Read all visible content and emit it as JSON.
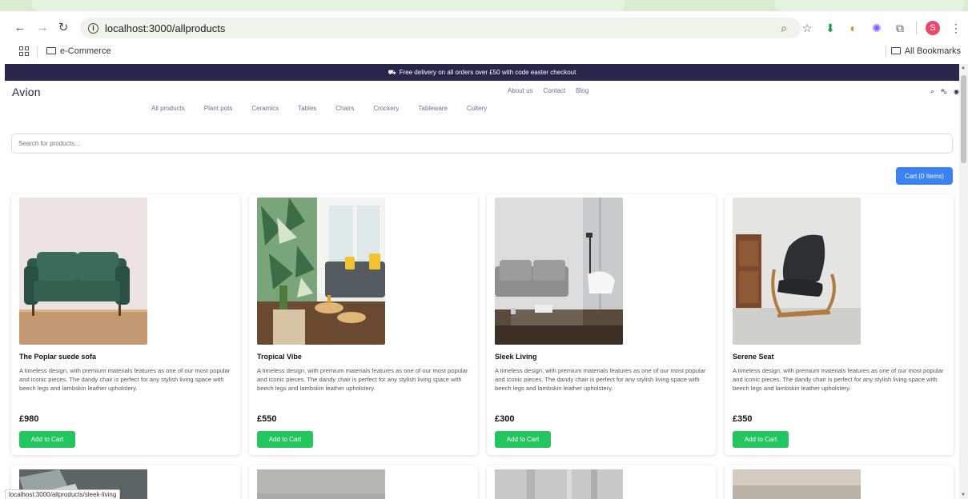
{
  "browser": {
    "url": "localhost:3000/allproducts",
    "bookmark_folder": "e-Commerce",
    "all_bookmarks": "All Bookmarks",
    "profile_initial": "S",
    "status_url": "localhost:3000/allproducts/sleek-living"
  },
  "site": {
    "promo": "Free delivery on all orders over £50 with code easter checkout",
    "logo": "Avion",
    "top_links": [
      "About us",
      "Contact",
      "Blog"
    ],
    "categories": [
      "All products",
      "Plant pots",
      "Ceramics",
      "Tables",
      "Chairs",
      "Crockery",
      "Tableware",
      "Cultery"
    ],
    "search_placeholder": "Search for products...",
    "cart_button": "Cart (0 Items)"
  },
  "products": [
    {
      "title": "The Poplar suede sofa",
      "description": "A timeless design, with premium materials features as one of our most popular and iconic pieces. The dandy chair is perfect for any stylish living space with beech legs and lambskin leather upholstery.",
      "price": "£980",
      "button": "Add to Cart"
    },
    {
      "title": "Tropical Vibe",
      "description": "A timeless design, with premium materials features as one of our most popular and iconic pieces. The dandy chair is perfect for any stylish living space with beech legs and lambskin leather upholstery.",
      "price": "£550",
      "button": "Add to Cart"
    },
    {
      "title": "Sleek Living",
      "description": "A timeless design, with premium materials features as one of our most popular and iconic pieces. The dandy chair is perfect for any stylish living space with beech legs and lambskin leather upholstery.",
      "price": "£300",
      "button": "Add to Cart"
    },
    {
      "title": "Serene Seat",
      "description": "A timeless design, with premium materials features as one of our most popular and iconic pieces. The dandy chair is perfect for any stylish living space with beech legs and lambskin leather upholstery.",
      "price": "£350",
      "button": "Add to Cart"
    }
  ],
  "colors": {
    "promo_bg": "#2a254b",
    "cart_button": "#3b82f6",
    "add_button": "#22c55e"
  }
}
